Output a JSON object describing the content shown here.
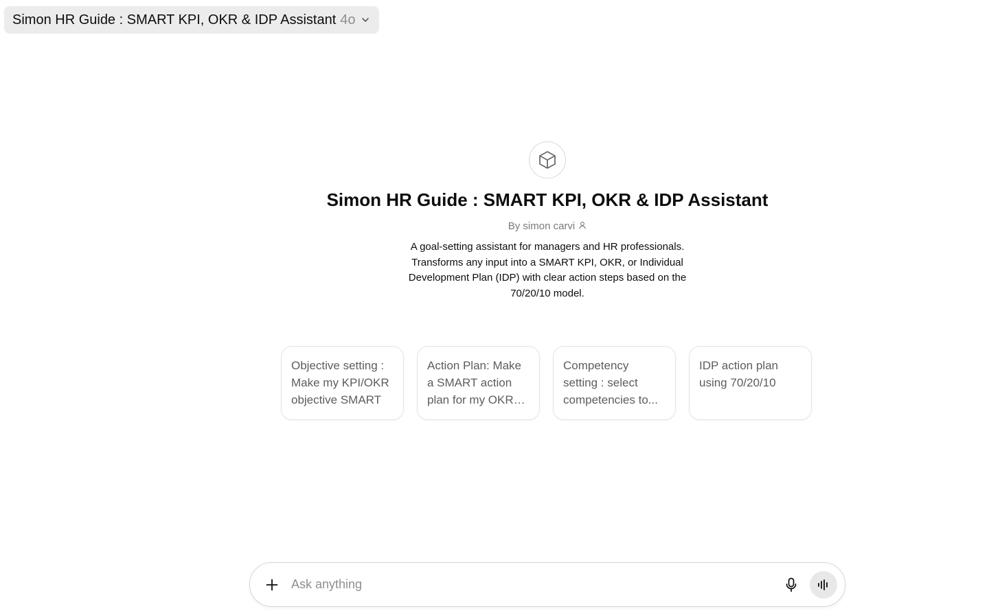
{
  "header": {
    "gpt_name": "Simon HR Guide : SMART KPI, OKR & IDP Assistant",
    "model_version": "4o"
  },
  "hero": {
    "title": "Simon HR Guide : SMART KPI, OKR & IDP Assistant",
    "author": "By simon carvi",
    "description": "A goal-setting assistant for managers and HR professionals. Transforms any input into a SMART KPI, OKR, or Individual Development Plan (IDP) with clear action steps based on the 70/20/10 model."
  },
  "starters": [
    {
      "text": "Objective setting : Make my KPI/OKR objective SMART"
    },
    {
      "text": "Action Plan: Make a SMART action plan for my OKR /KPI"
    },
    {
      "text": "Competency setting : select competencies to..."
    },
    {
      "text": "IDP action plan using 70/20/10"
    }
  ],
  "composer": {
    "placeholder": "Ask anything"
  },
  "icons": {
    "avatar": "cube-icon",
    "author": "person-icon",
    "dropdown": "chevron-down-icon",
    "attach": "plus-icon",
    "mic": "microphone-icon",
    "voice": "voice-waveform-icon"
  }
}
